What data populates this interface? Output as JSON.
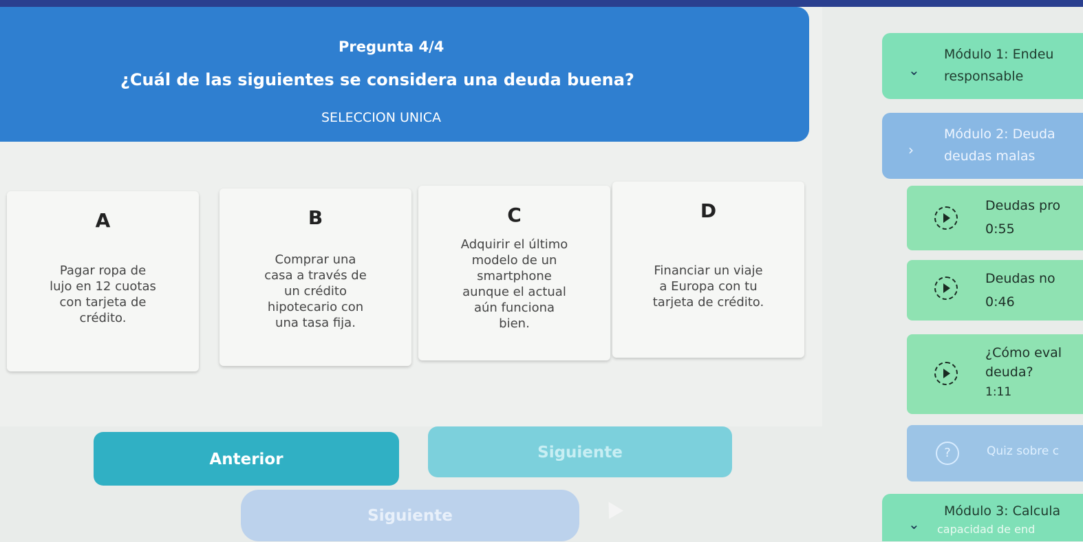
{
  "question": {
    "counter": "Pregunta 4/4",
    "text": "¿Cuál de las siguientes se considera una deuda buena?",
    "type": "SELECCION UNICA"
  },
  "options": [
    {
      "letter": "A",
      "text": "Pagar ropa de\nlujo en 12 cuotas\ncon tarjeta de\ncrédito."
    },
    {
      "letter": "B",
      "text": "Comprar una\ncasa a través de\nun crédito\nhipotecario con\nuna tasa fija."
    },
    {
      "letter": "C",
      "text": "Adquirir el último\nmodelo de un\nsmartphone\naunque el actual\naún funciona\nbien."
    },
    {
      "letter": "D",
      "text": "Financiar un viaje\na Europa con tu\ntarjeta de crédito."
    }
  ],
  "buttons": {
    "prev": "Anterior",
    "next": "Siguiente",
    "next_lower": "Siguiente"
  },
  "sidebar": {
    "module1": {
      "title": "Módulo 1: Endeu",
      "subtitle": "responsable"
    },
    "module2": {
      "title": "Módulo 2: Deuda",
      "subtitle": "deudas malas"
    },
    "lessons": [
      {
        "title": "Deudas pro",
        "time": "0:55"
      },
      {
        "title": "Deudas no",
        "time": "0:46"
      },
      {
        "title": "¿Cómo eval",
        "title2": "deuda?",
        "time": "1:11"
      }
    ],
    "quiz": {
      "label": "Quiz sobre c"
    },
    "module3": {
      "title": "Módulo 3: Calcula",
      "subtitle": "capacidad de end"
    }
  },
  "colors": {
    "banner": "#2f7fd0",
    "prev_button": "#30b0c4",
    "next_button": "#7cd0dc",
    "module_green": "#7fe0b7",
    "module_blue": "#89b8e4"
  }
}
